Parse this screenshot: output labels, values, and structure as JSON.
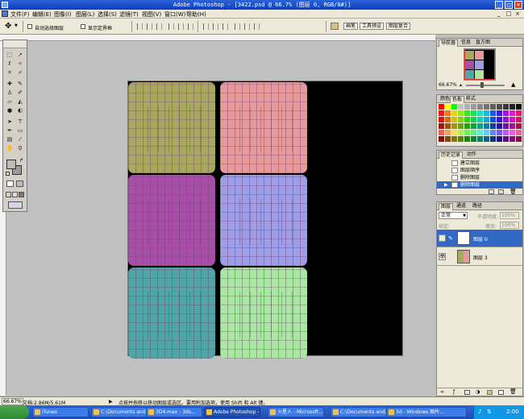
{
  "window": {
    "title": "Adobe Photoshop - [3422.psd @ 66.7% (图层 0, RGB/8#)]",
    "controls": [
      "_",
      "□",
      "×"
    ]
  },
  "menu": [
    {
      "label": "文件(F)"
    },
    {
      "label": "编辑(E)"
    },
    {
      "label": "图像(I)"
    },
    {
      "label": "图层(L)"
    },
    {
      "label": "选择(S)"
    },
    {
      "label": "滤镜(T)"
    },
    {
      "label": "视图(V)"
    },
    {
      "label": "窗口(W)"
    },
    {
      "label": "帮助(H)"
    }
  ],
  "options_bar": {
    "auto_select_label": "自动选择图层",
    "show_bounds_label": "显示定界框",
    "workspace_tabs": [
      "画笔",
      "工具预设",
      "图层复合"
    ]
  },
  "canvas": {
    "tiles": [
      {
        "name": "tile-olive",
        "color": "#a8a85e",
        "row": 0,
        "col": 0
      },
      {
        "name": "tile-salmon",
        "color": "#e89a9a",
        "row": 0,
        "col": 1
      },
      {
        "name": "tile-purple",
        "color": "#a94ea8",
        "row": 1,
        "col": 0
      },
      {
        "name": "tile-lavender",
        "color": "#9e9ee8",
        "row": 1,
        "col": 1
      },
      {
        "name": "tile-teal",
        "color": "#4fa6a6",
        "row": 2,
        "col": 0
      },
      {
        "name": "tile-green",
        "color": "#a8e8a0",
        "row": 2,
        "col": 1
      }
    ],
    "background": "#000000"
  },
  "navigator": {
    "tabs": [
      "导航器",
      "信息",
      "直方图"
    ],
    "zoom": "66.67%"
  },
  "color_panel": {
    "tabs": [
      "颜色",
      "色板",
      "样式"
    ]
  },
  "history": {
    "tabs": [
      "历史记录",
      "动作"
    ],
    "items": [
      "建立图层",
      "图层顺序",
      "删除图层",
      "删除图层"
    ],
    "selected_index": 3
  },
  "layers": {
    "tabs": [
      "图层",
      "通道",
      "路径"
    ],
    "blend_mode": "正常",
    "opacity_label": "不透明度:",
    "opacity": "100%",
    "fill_label": "填充:",
    "fill": "100%",
    "lock_label": "锁定:",
    "items": [
      {
        "name": "图层 0",
        "selected": true
      },
      {
        "name": "图层 3",
        "selected": false
      }
    ]
  },
  "status": {
    "zoom": "66.67%",
    "doc": "文档:2.86M/5.61M",
    "hint": "点按并拖移以移动图层或选区。要用附加选项，使用 Shift 和 Alt 键。"
  },
  "taskbar": {
    "tasks": [
      {
        "label": "iTunes",
        "active": false
      },
      {
        "label": "C:\\Documents and...",
        "active": false
      },
      {
        "label": "3D4.max - 3ds...",
        "active": false
      },
      {
        "label": "Adobe Photoshop -...",
        "active": true
      },
      {
        "label": "火星人 - Microsoft...",
        "active": false
      },
      {
        "label": "C:\\Documents and...",
        "active": false
      },
      {
        "label": "3d - Windows 图片...",
        "active": false
      }
    ],
    "clock": "2:00"
  },
  "colors": {
    "title_bar": "#0a3fbf",
    "selection": "#316ac5"
  }
}
